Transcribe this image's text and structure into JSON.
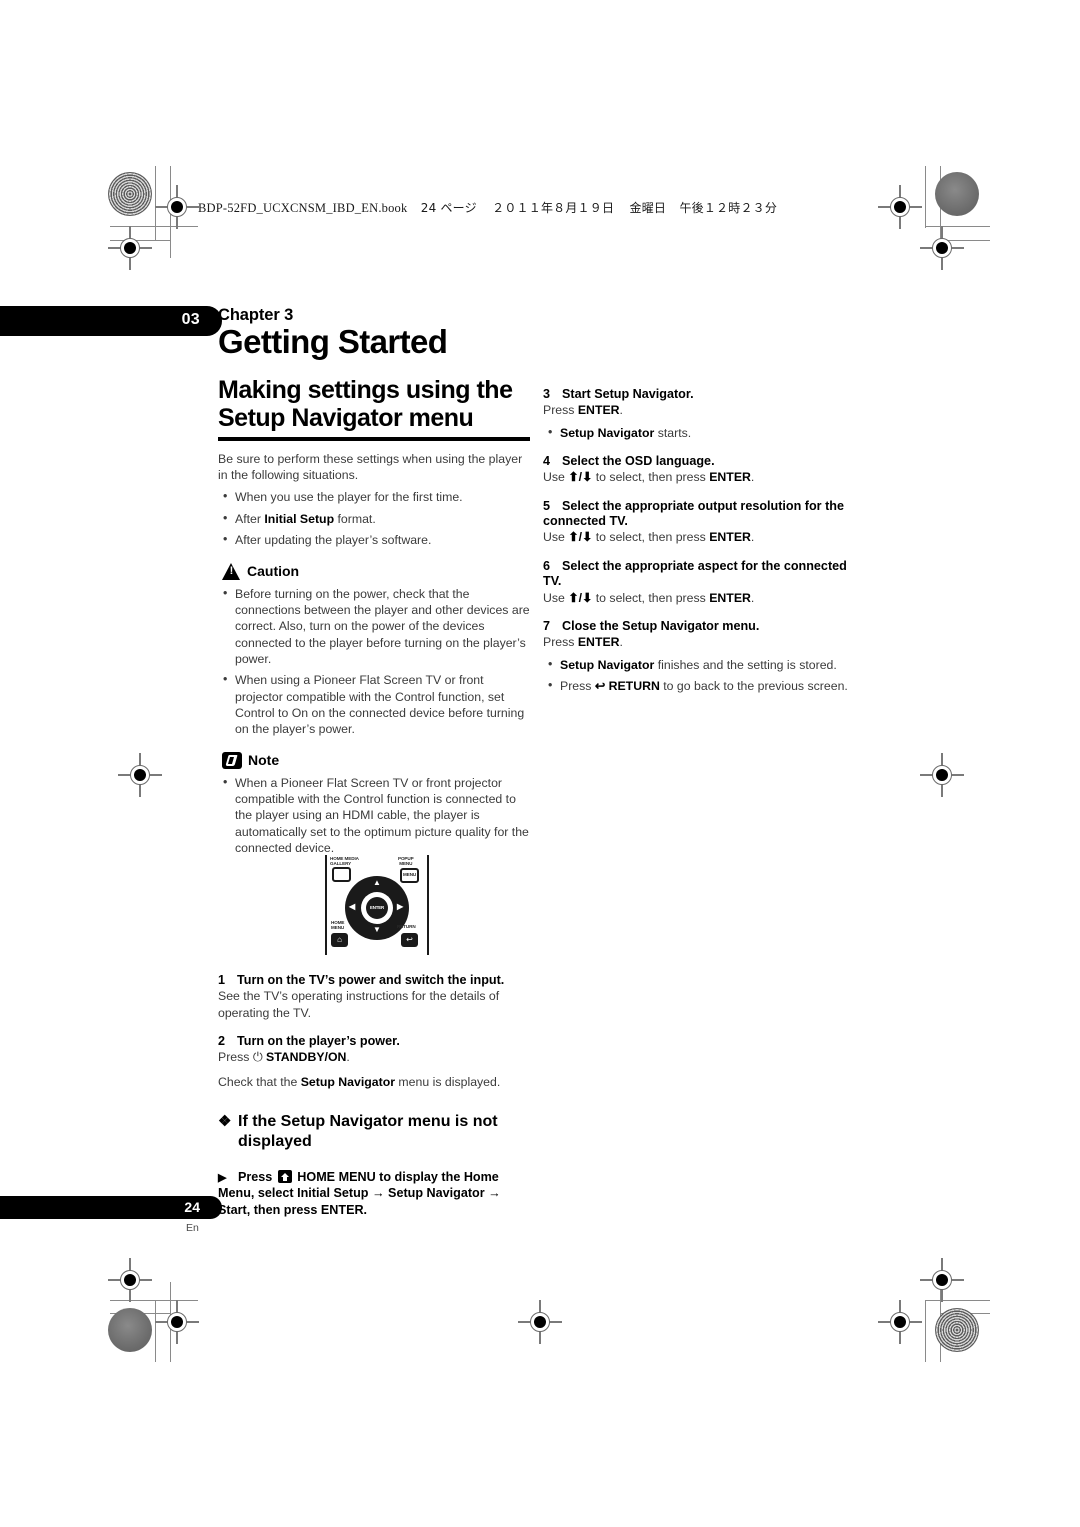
{
  "file_header": {
    "filename": "BDP-52FD_UCXCNSM_IBD_EN.book",
    "page_label": "24 ページ",
    "date": "２０１１年８月１９日",
    "weekday": "金曜日",
    "time": "午後１２時２３分"
  },
  "chapter_tab": "03",
  "chapter_label": "Chapter 3",
  "doc_title": "Getting Started",
  "section_title": "Making settings using the Setup Navigator menu",
  "intro": "Be sure to perform these settings when using the player in the following situations.",
  "intro_bullets": [
    {
      "pre": "When you use the player for the first time.",
      "bold": "",
      "post": ""
    },
    {
      "pre": "After ",
      "bold": "Initial Setup",
      "post": " format."
    },
    {
      "pre": "After updating the player’s software.",
      "bold": "",
      "post": ""
    }
  ],
  "caution": {
    "title": "Caution",
    "icon": "warning-triangle-icon",
    "bullets": [
      "Before turning on the power, check that the connections between the player and other devices are correct. Also, turn on the power of the devices connected to the player before turning on the player’s power.",
      "When using a Pioneer Flat Screen TV or front projector compatible with the Control function, set Control to On on the connected device before turning on the player’s power."
    ]
  },
  "note": {
    "title": "Note",
    "icon": "pencil-note-icon",
    "bullets": [
      "When a Pioneer Flat Screen TV or front projector compatible with the Control function is connected to the player using an HDMI cable, the player is automatically set to the optimum picture quality for the connected device."
    ]
  },
  "remote": {
    "label_home_media_gallery": "HOME MEDIA\nGALLERY",
    "label_popup_menu": "POPUP\nMENU",
    "label_menu_button": "MENU",
    "label_enter": "ENTER",
    "label_home_menu": "HOME\nMENU",
    "label_return": "RETURN",
    "arrow_up": "↑",
    "arrow_down": "↓",
    "arrow_left": "←",
    "arrow_right": "→"
  },
  "steps": [
    {
      "num": "1",
      "head": "Turn on the TV’s power and switch the input.",
      "lines": [
        {
          "parts": [
            {
              "t": "See the TV’s operating instructions for the details of operating the TV.",
              "b": false
            }
          ]
        }
      ],
      "bullets": []
    },
    {
      "num": "2",
      "head": "Turn on the player’s power.",
      "lines": [
        {
          "parts": [
            {
              "t": "Press ",
              "b": false
            },
            {
              "t": "⏻ ",
              "b": false
            },
            {
              "t": "STANDBY/ON",
              "b": true
            },
            {
              "t": ".",
              "b": false
            }
          ]
        },
        {
          "parts": [
            {
              "t": "Check that the ",
              "b": false
            },
            {
              "t": "Setup Navigator",
              "b": true
            },
            {
              "t": " menu is displayed.",
              "b": false
            }
          ]
        }
      ],
      "bullets": []
    },
    {
      "num": "3",
      "head": "Start Setup Navigator.",
      "lines": [
        {
          "parts": [
            {
              "t": "Press ",
              "b": false
            },
            {
              "t": "ENTER",
              "b": true
            },
            {
              "t": ".",
              "b": false
            }
          ]
        }
      ],
      "bullets": [
        {
          "parts": [
            {
              "t": "Setup Navigator",
              "b": true
            },
            {
              "t": " starts.",
              "b": false
            }
          ]
        }
      ]
    },
    {
      "num": "4",
      "head": "Select the OSD language.",
      "lines": [
        {
          "parts": [
            {
              "t": "Use ",
              "b": false
            },
            {
              "t": "⬆/⬇",
              "b": true
            },
            {
              "t": " to select, then press ",
              "b": false
            },
            {
              "t": "ENTER",
              "b": true
            },
            {
              "t": ".",
              "b": false
            }
          ]
        }
      ],
      "bullets": []
    },
    {
      "num": "5",
      "head": "Select the appropriate output resolution for the connected TV.",
      "lines": [
        {
          "parts": [
            {
              "t": "Use ",
              "b": false
            },
            {
              "t": "⬆/⬇",
              "b": true
            },
            {
              "t": " to select, then press ",
              "b": false
            },
            {
              "t": "ENTER",
              "b": true
            },
            {
              "t": ".",
              "b": false
            }
          ]
        }
      ],
      "bullets": []
    },
    {
      "num": "6",
      "head": "Select the appropriate aspect for the connected TV.",
      "lines": [
        {
          "parts": [
            {
              "t": "Use ",
              "b": false
            },
            {
              "t": "⬆/⬇",
              "b": true
            },
            {
              "t": " to select, then press ",
              "b": false
            },
            {
              "t": "ENTER",
              "b": true
            },
            {
              "t": ".",
              "b": false
            }
          ]
        }
      ],
      "bullets": []
    },
    {
      "num": "7",
      "head": "Close the Setup Navigator menu.",
      "lines": [
        {
          "parts": [
            {
              "t": "Press ",
              "b": false
            },
            {
              "t": "ENTER",
              "b": true
            },
            {
              "t": ".",
              "b": false
            }
          ]
        }
      ],
      "bullets": [
        {
          "parts": [
            {
              "t": "Setup Navigator",
              "b": true
            },
            {
              "t": " finishes and the setting is stored.",
              "b": false
            }
          ]
        },
        {
          "parts": [
            {
              "t": "Press ",
              "b": false
            },
            {
              "t": "↩ ",
              "b": true
            },
            {
              "t": "RETURN",
              "b": true
            },
            {
              "t": " to go back to the previous screen.",
              "b": false
            }
          ]
        }
      ]
    }
  ],
  "sub_heading": {
    "diamond": "❖",
    "text": "If the Setup Navigator menu is not displayed"
  },
  "arrow_instruction": {
    "pointer": "▶",
    "part1": "Press",
    "icon": "home-menu-icon",
    "part2": "HOME MENU to display the Home Menu, select Initial Setup → Setup Navigator → Start, then press ENTER."
  },
  "footer": {
    "page_number": "24",
    "language": "En"
  },
  "colors": {
    "ink": "#000000",
    "body_text": "#3b3b3b",
    "reg_mark": "#6a6a6a"
  }
}
